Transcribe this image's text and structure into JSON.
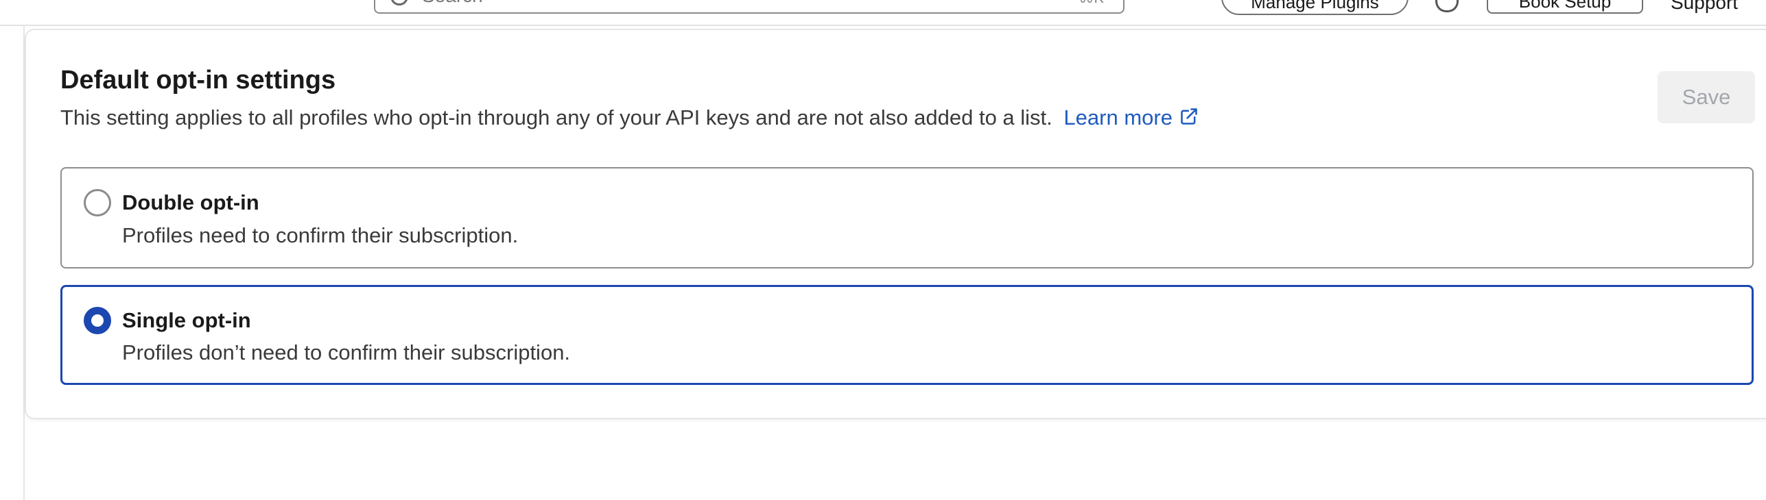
{
  "header": {
    "search": {
      "placeholder": "Search",
      "shortcut_hint": "⌘K"
    },
    "pill_button_label": "Manage Plugins",
    "box_button_label": "Book Setup",
    "support_label": "Support"
  },
  "settings": {
    "title": "Default opt-in settings",
    "description": "This setting applies to all profiles who opt-in through any of your API keys and are not also added to a list.",
    "learn_more_label": "Learn more",
    "save_label": "Save",
    "options": [
      {
        "label": "Double opt-in",
        "description": "Profiles need to confirm their subscription.",
        "selected": false
      },
      {
        "label": "Single opt-in",
        "description": "Profiles don’t need to confirm their subscription.",
        "selected": true
      }
    ]
  },
  "colors": {
    "accent": "#1c47b0",
    "link": "#1f5bbf",
    "disabled_text": "#a3a6ab",
    "disabled_bg": "#f0f0f1"
  },
  "icons": [
    "search-icon",
    "bell-icon",
    "external-link-icon",
    "radio-unchecked-icon",
    "radio-checked-icon"
  ]
}
